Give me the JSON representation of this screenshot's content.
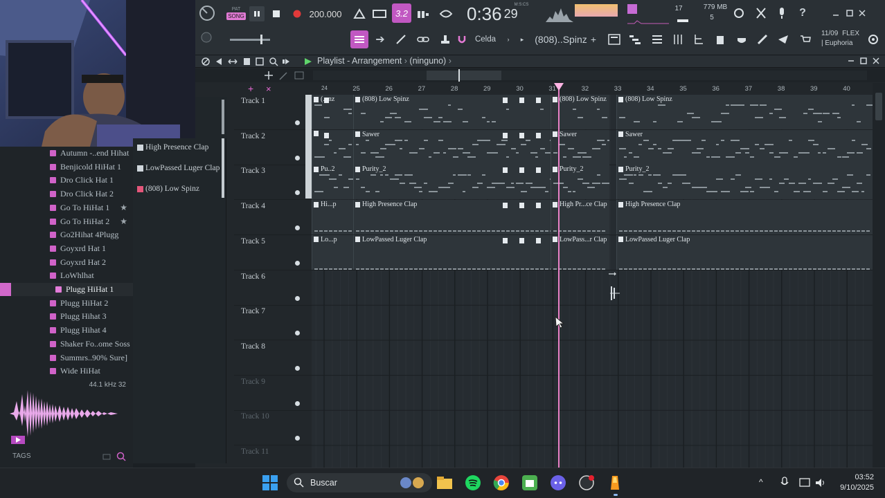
{
  "toolbar": {
    "pat_label": "PAT",
    "song_label": "SONG",
    "tempo": "200.000",
    "pattern_num": "3.2",
    "time_label": "M:S:CS",
    "time_main": "0:36",
    "time_cs": "29",
    "cpu_count": "17",
    "mem": "779 MB",
    "poly": "5",
    "snap_label": "Celda",
    "channel_selector": "(808)..Spinz",
    "hint_date": "11/09",
    "hint_flex": "FLEX",
    "hint_preset": "| Euphoria"
  },
  "playlist": {
    "title": "Playlist - Arrangement",
    "arrangement": "(ninguno)"
  },
  "ruler": [
    "24",
    "25",
    "26",
    "27",
    "28",
    "29",
    "30",
    "31",
    "32",
    "33",
    "34",
    "35",
    "36",
    "37",
    "38",
    "39",
    "40"
  ],
  "tracks": [
    {
      "name": "Track 1"
    },
    {
      "name": "Track 2"
    },
    {
      "name": "Track 3"
    },
    {
      "name": "Track 4"
    },
    {
      "name": "Track 5"
    },
    {
      "name": "Track 6"
    },
    {
      "name": "Track 7"
    },
    {
      "name": "Track 8"
    },
    {
      "name": "Track 9"
    },
    {
      "name": "Track 10"
    },
    {
      "name": "Track 11"
    }
  ],
  "clips": {
    "t1a": "(...nz",
    "t1b": "(808) Low Spinz",
    "t1c": "(808) Low Spinz",
    "t1d": "(808) Low Spinz",
    "t2b": "Sawer",
    "t2c": "Sawer",
    "t2d": "Sawer",
    "t3a": "Pu..2",
    "t3b": "Purity_2",
    "t3c": "Purity_2",
    "t3d": "Purity_2",
    "t4a": "Hi...p",
    "t4b": "High Presence Clap",
    "t4c": "High Pr...ce Clap",
    "t4d": "High Presence Clap",
    "t5a": "Lo...p",
    "t5b": "LowPassed Luger Clap",
    "t5c": "LowPass...r Clap",
    "t5d": "LowPassed Luger Clap"
  },
  "picker": [
    "High Presence Clap",
    "LowPassed Luger Clap",
    "(808) Low Spinz"
  ],
  "browser": {
    "items": [
      "Autumn -..end Hihat",
      "Benjicold HiHat 1",
      "Dro Click Hat 1",
      "Dro Click Hat 2",
      "Go To HiHat 1",
      "Go To HiHat 2",
      "Go2Hihat 4Plugg",
      "Goyxrd Hat 1",
      "Goyxrd Hat 2",
      "LoWhlhat",
      "Plugg HiHat 1",
      "Plugg HiHat 2",
      "Plugg Hihat 3",
      "Plugg Hihat 4",
      "Shaker Fo..ome Soss",
      "Summrs..90% Sure]",
      "Wide HiHat"
    ],
    "sample_info": "44.1 kHz 32",
    "tags_label": "TAGS"
  },
  "taskbar": {
    "search_placeholder": "Buscar",
    "time": "03:52",
    "date": "9/10/2025"
  },
  "colors": {
    "accent": "#d062c8",
    "playhead": "#ff7bd2",
    "bg": "#22272b"
  }
}
